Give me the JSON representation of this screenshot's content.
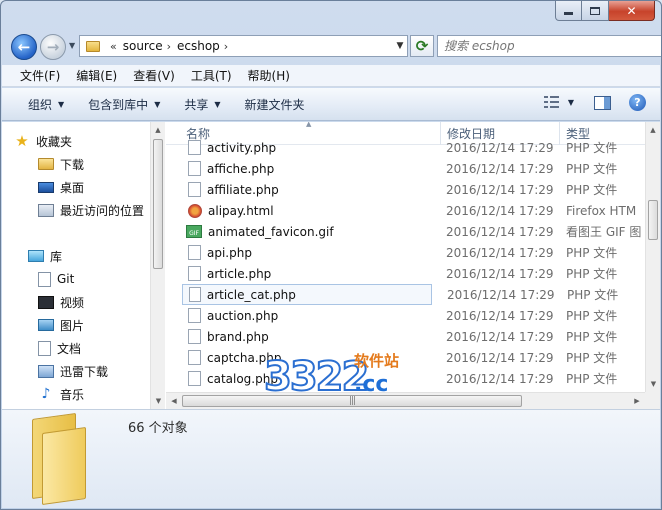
{
  "address": {
    "history_glyph": "«",
    "crumbs": [
      "source",
      "ecshop"
    ],
    "separator": "›"
  },
  "search": {
    "placeholder": "搜索 ecshop"
  },
  "menubar": [
    "文件(F)",
    "编辑(E)",
    "查看(V)",
    "工具(T)",
    "帮助(H)"
  ],
  "toolbar": {
    "organize": "组织",
    "include_library": "包含到库中",
    "share": "共享",
    "new_folder": "新建文件夹"
  },
  "nav": {
    "favorites": "收藏夹",
    "downloads": "下载",
    "desktop": "桌面",
    "recent": "最近访问的位置",
    "libraries": "库",
    "git": "Git",
    "video": "视频",
    "pictures": "图片",
    "documents": "文档",
    "thunder_downloads": "迅雷下载",
    "music": "音乐"
  },
  "columns": {
    "name": "名称",
    "date": "修改日期",
    "type": "类型"
  },
  "files": [
    {
      "name": "activity.php",
      "date": "2016/12/14 17:29",
      "type": "PHP 文件",
      "icon": "php"
    },
    {
      "name": "affiche.php",
      "date": "2016/12/14 17:29",
      "type": "PHP 文件",
      "icon": "php"
    },
    {
      "name": "affiliate.php",
      "date": "2016/12/14 17:29",
      "type": "PHP 文件",
      "icon": "php"
    },
    {
      "name": "alipay.html",
      "date": "2016/12/14 17:29",
      "type": "Firefox HTM",
      "icon": "html"
    },
    {
      "name": "animated_favicon.gif",
      "date": "2016/12/14 17:29",
      "type": "看图王 GIF 图",
      "icon": "gif"
    },
    {
      "name": "api.php",
      "date": "2016/12/14 17:29",
      "type": "PHP 文件",
      "icon": "php"
    },
    {
      "name": "article.php",
      "date": "2016/12/14 17:29",
      "type": "PHP 文件",
      "icon": "php"
    },
    {
      "name": "article_cat.php",
      "date": "2016/12/14 17:29",
      "type": "PHP 文件",
      "icon": "php",
      "selected": true
    },
    {
      "name": "auction.php",
      "date": "2016/12/14 17:29",
      "type": "PHP 文件",
      "icon": "php"
    },
    {
      "name": "brand.php",
      "date": "2016/12/14 17:29",
      "type": "PHP 文件",
      "icon": "php"
    },
    {
      "name": "captcha.php",
      "date": "2016/12/14 17:29",
      "type": "PHP 文件",
      "icon": "php"
    },
    {
      "name": "catalog.php",
      "date": "2016/12/14 17:29",
      "type": "PHP 文件",
      "icon": "php"
    }
  ],
  "status": {
    "object_count": "66 个对象"
  },
  "watermark": {
    "number": "3322",
    "suffix": ".cc",
    "site": "软件站"
  },
  "colors": {
    "accent": "#3399ff",
    "selection_border": "#a9c4e4",
    "watermark_orange": "#e47a1c",
    "watermark_blue": "#1f6fd6"
  }
}
